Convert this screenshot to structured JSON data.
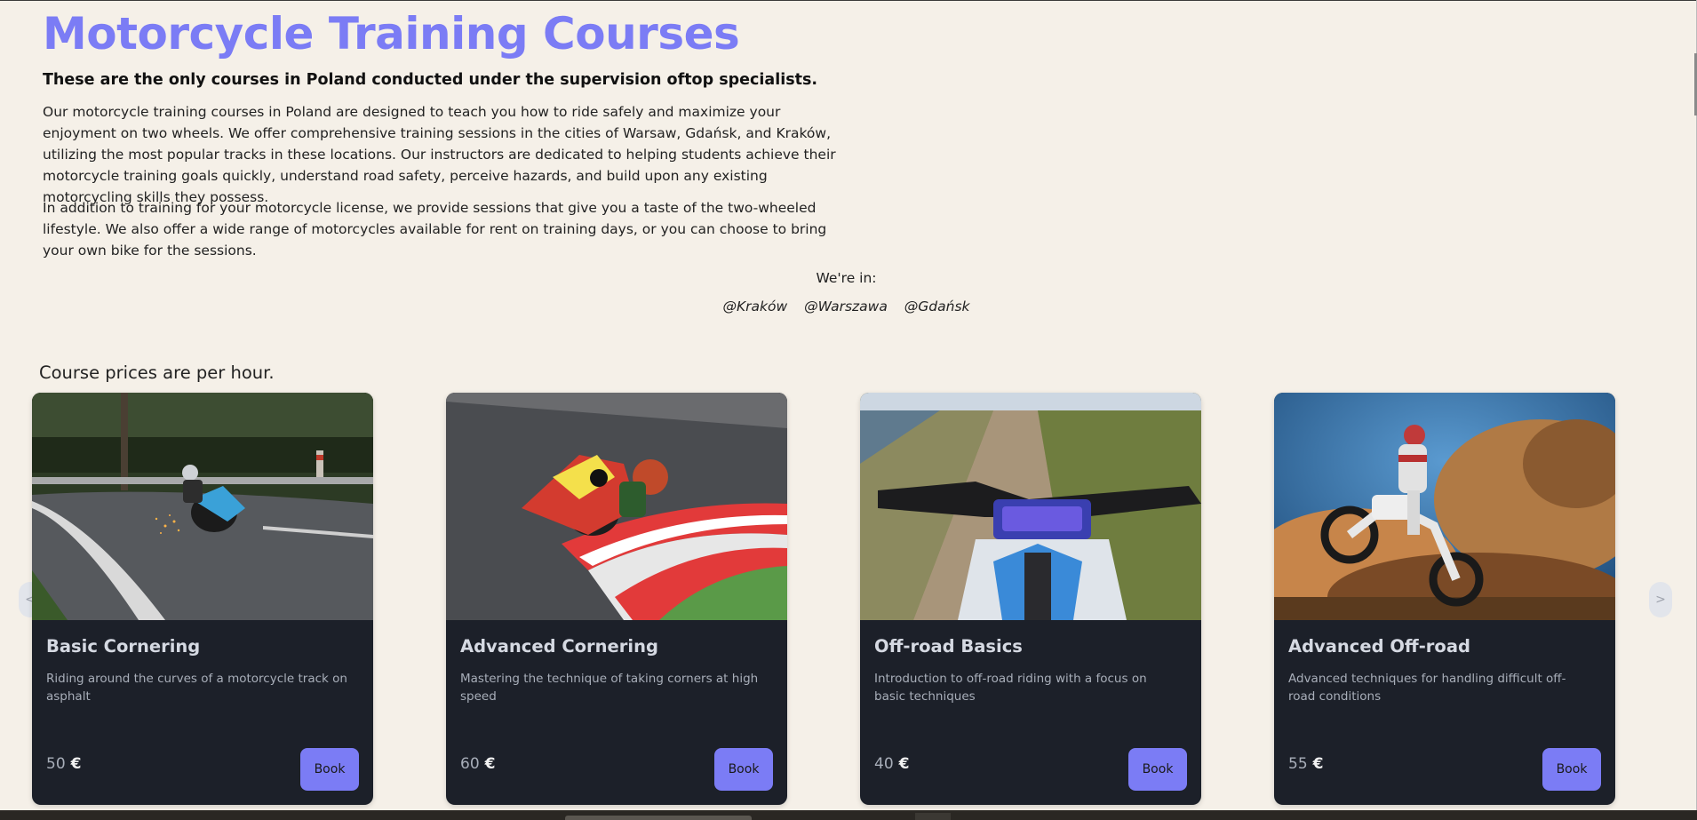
{
  "header": {
    "title": "Motorcycle Training Courses",
    "subtitle": "These are the only courses in Poland conducted under the supervision oftop specialists.",
    "paragraph1": "Our motorcycle training courses in Poland are designed to teach you how to ride safely and maximize your enjoyment on two wheels. We offer comprehensive training sessions in the cities of Warsaw, Gdańsk, and Kraków, utilizing the most popular tracks in these locations. Our instructors are dedicated to helping students achieve their motorcycle training goals quickly, understand road safety, perceive hazards, and build upon any existing motorcycling skills they possess.",
    "paragraph2": "In addition to training for your motorcycle license, we provide sessions that give you a taste of the two-wheeled lifestyle. We also offer a wide range of motorcycles available for rent on training days, or you can choose to bring your own bike for the sessions."
  },
  "locations": {
    "label": "We're in:",
    "items": [
      "@Kraków",
      "@Warszawa",
      "@Gdańsk"
    ]
  },
  "courses": {
    "note": "Course prices are per hour.",
    "currency_symbol": "€",
    "book_label": "Book",
    "prev_label": "<",
    "next_label": ">",
    "items": [
      {
        "title": "Basic Cornering",
        "description": "Riding around the curves of a motorcycle track on asphalt",
        "price": "50",
        "image": "road-cornering-photo"
      },
      {
        "title": "Advanced Cornering",
        "description": "Mastering the technique of taking corners at high speed",
        "price": "60",
        "image": "track-racing-photo"
      },
      {
        "title": "Off-road Basics",
        "description": "Introduction to off-road riding with a focus on basic techniques",
        "price": "40",
        "image": "dirt-trail-photo"
      },
      {
        "title": "Advanced Off-road",
        "description": "Advanced techniques for handling difficult off-road conditions",
        "price": "55",
        "image": "dust-jump-photo"
      }
    ]
  },
  "colors": {
    "accent": "#7b7cf5",
    "background": "#f5f0e8",
    "card_bg": "#1c2029"
  }
}
